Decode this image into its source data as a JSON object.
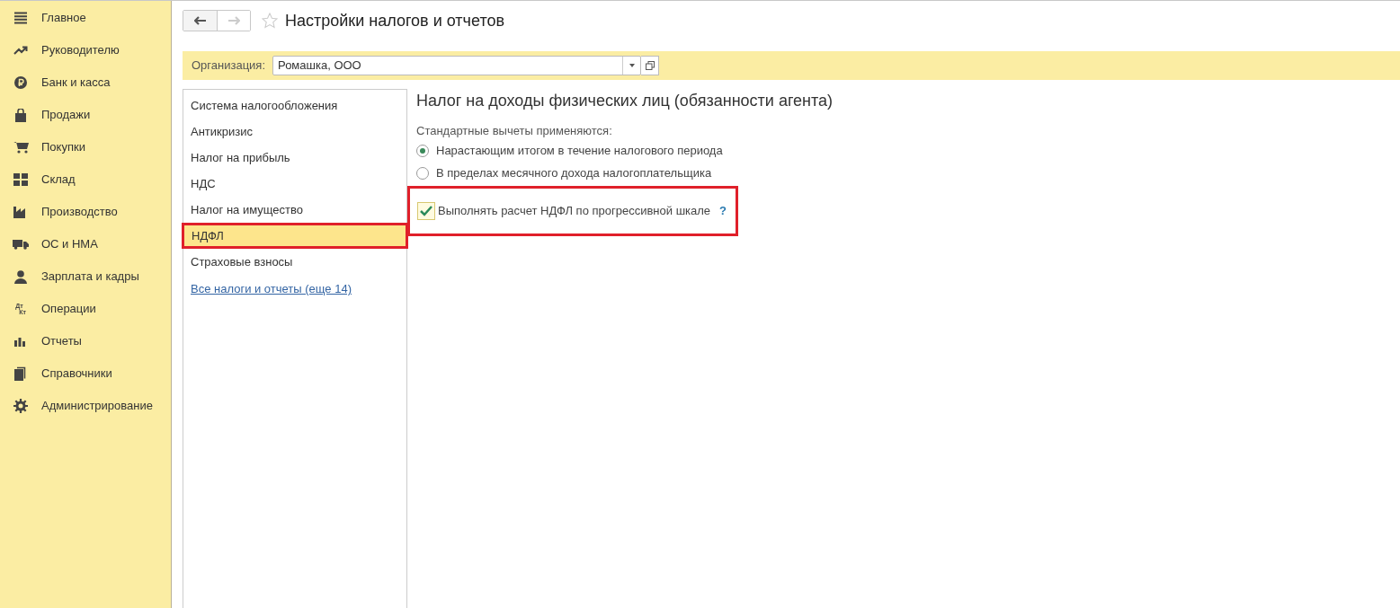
{
  "sidebar": {
    "items": [
      {
        "label": "Главное"
      },
      {
        "label": "Руководителю"
      },
      {
        "label": "Банк и касса"
      },
      {
        "label": "Продажи"
      },
      {
        "label": "Покупки"
      },
      {
        "label": "Склад"
      },
      {
        "label": "Производство"
      },
      {
        "label": "ОС и НМА"
      },
      {
        "label": "Зарплата и кадры"
      },
      {
        "label": "Операции",
        "icon_text": [
          "Дт",
          "Кт"
        ]
      },
      {
        "label": "Отчеты"
      },
      {
        "label": "Справочники"
      },
      {
        "label": "Администрирование"
      }
    ]
  },
  "window": {
    "title": "Настройки налогов и отчетов",
    "favorite": false
  },
  "organization": {
    "label": "Организация:",
    "value": "Ромашка, ООО"
  },
  "sections": {
    "items": [
      {
        "label": "Система налогообложения",
        "selected": false,
        "highlighted": false
      },
      {
        "label": "Антикризис",
        "selected": false,
        "highlighted": false
      },
      {
        "label": "Налог на прибыль",
        "selected": false,
        "highlighted": false
      },
      {
        "label": "НДС",
        "selected": false,
        "highlighted": false
      },
      {
        "label": "Налог на имущество",
        "selected": false,
        "highlighted": false
      },
      {
        "label": "НДФЛ",
        "selected": true,
        "highlighted": true
      },
      {
        "label": "Страховые взносы",
        "selected": false,
        "highlighted": false
      }
    ],
    "link": "Все налоги и отчеты (еще 14)"
  },
  "panel": {
    "heading": "Налог на доходы физических лиц (обязанности агента)",
    "deductions_label": "Стандартные вычеты применяются:",
    "deductions_options": [
      {
        "label": "Нарастающим итогом в течение налогового периода",
        "selected": true
      },
      {
        "label": "В пределах месячного дохода налогоплательщика",
        "selected": false
      }
    ],
    "progressive": {
      "label": "Выполнять расчет НДФЛ по прогрессивной шкале",
      "checked": true,
      "highlighted": true,
      "help": "?"
    }
  }
}
